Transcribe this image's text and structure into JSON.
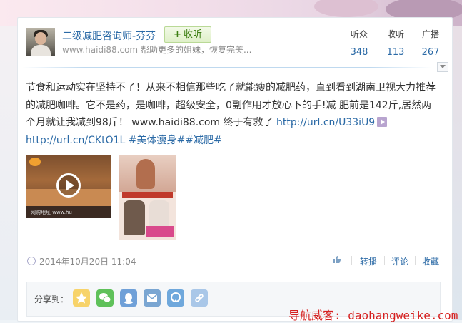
{
  "user": {
    "name": "二级减肥咨询师-芬芬",
    "desc_url": "www.haidi88.com",
    "desc_text": " 帮助更多的姐妹，恢复完美...",
    "follow_label": "收听",
    "follow_plus": "+"
  },
  "stats": [
    {
      "label": "听众",
      "value": "348"
    },
    {
      "label": "收听",
      "value": "113"
    },
    {
      "label": "广播",
      "value": "267"
    }
  ],
  "post": {
    "text_part1": "节食和运动实在坚持不了！从来不相信那些吃了就能瘦的减肥药，直到看到湖南卫视大力推荐的减肥咖啡。它不是药，是咖啡，超级安全，0副作用才放心下的手!减 肥前是142斤,居然两个月就让我减到98斤！ www.haidi88.com 终于有救了",
    "link1": "http://url.cn/U33iU9",
    "link2": "http://url.cn/CKtO1L",
    "tag1": "#美体瘦身#",
    "tag2": "#减肥#",
    "video_caption": "网购地址 www.hu"
  },
  "meta": {
    "time": "2014年10月20日 11:04",
    "actions": [
      "转播",
      "评论",
      "收藏"
    ]
  },
  "share": {
    "label": "分享到：",
    "icons": [
      "star-icon",
      "wechat-icon",
      "qq-icon",
      "mail-icon",
      "qzone-icon",
      "link-icon"
    ]
  },
  "watermark": "导航威客: daohangweike.com",
  "colors": {
    "link": "#2b6aa6",
    "follow_green": "#3b7d10",
    "watermark_red": "#d62020"
  }
}
